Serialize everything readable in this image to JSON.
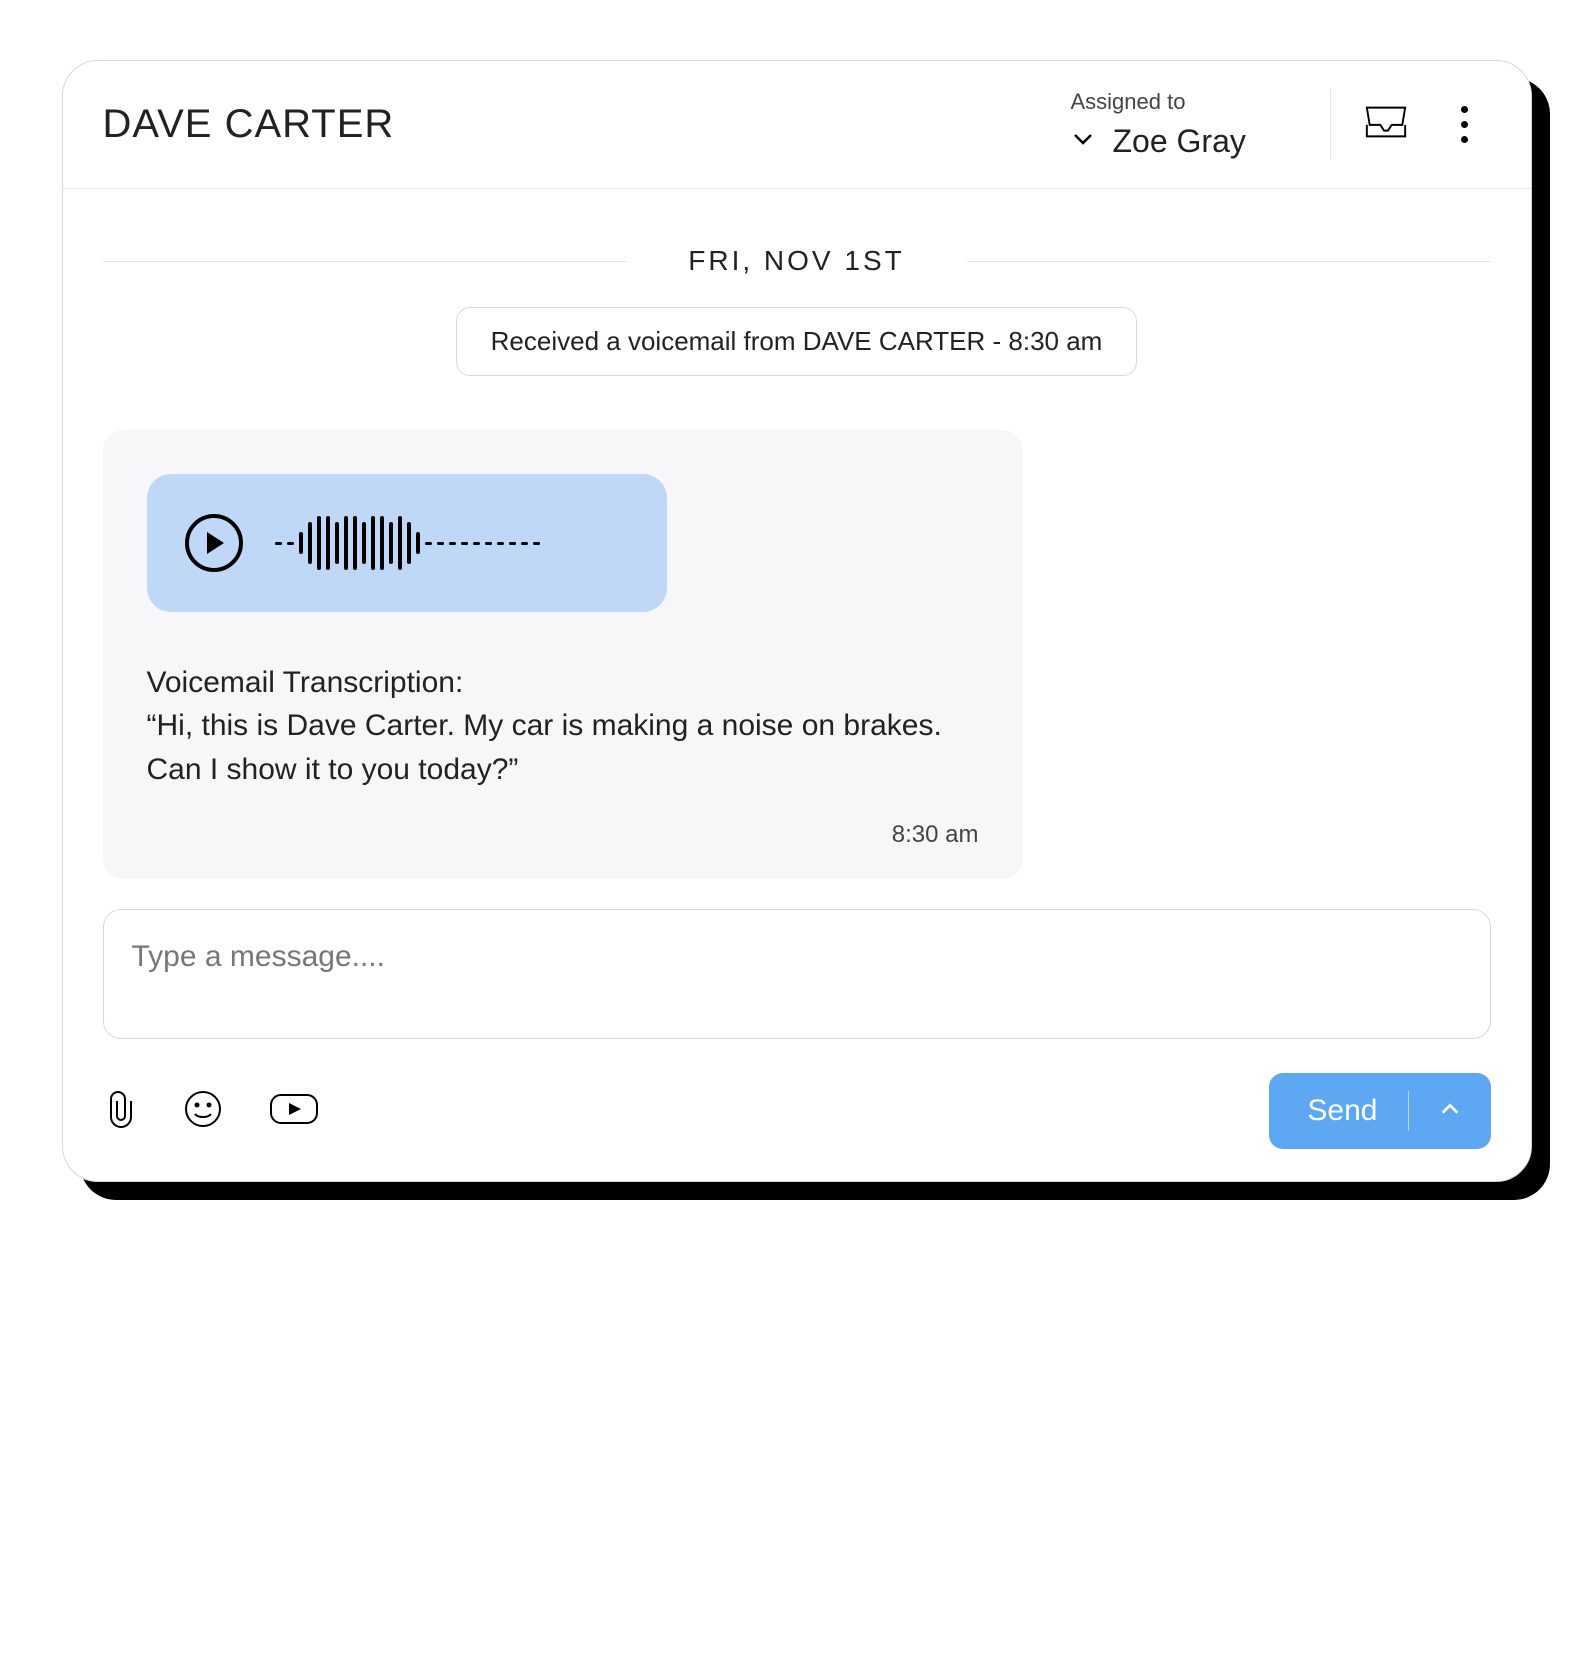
{
  "header": {
    "contact_name": "DAVE CARTER",
    "assigned_label": "Assigned to",
    "assigned_to": "Zoe Gray"
  },
  "thread": {
    "date_separator": "FRI, NOV 1ST",
    "event_pill": "Received a voicemail from DAVE CARTER - 8:30 am",
    "voicemail": {
      "transcription_label": "Voicemail Transcription:",
      "transcription_text": "“Hi, this is Dave Carter. My car is making a noise on brakes. Can I show it to you today?”",
      "timestamp": "8:30 am"
    }
  },
  "composer": {
    "placeholder": "Type a message....",
    "send_label": "Send"
  }
}
